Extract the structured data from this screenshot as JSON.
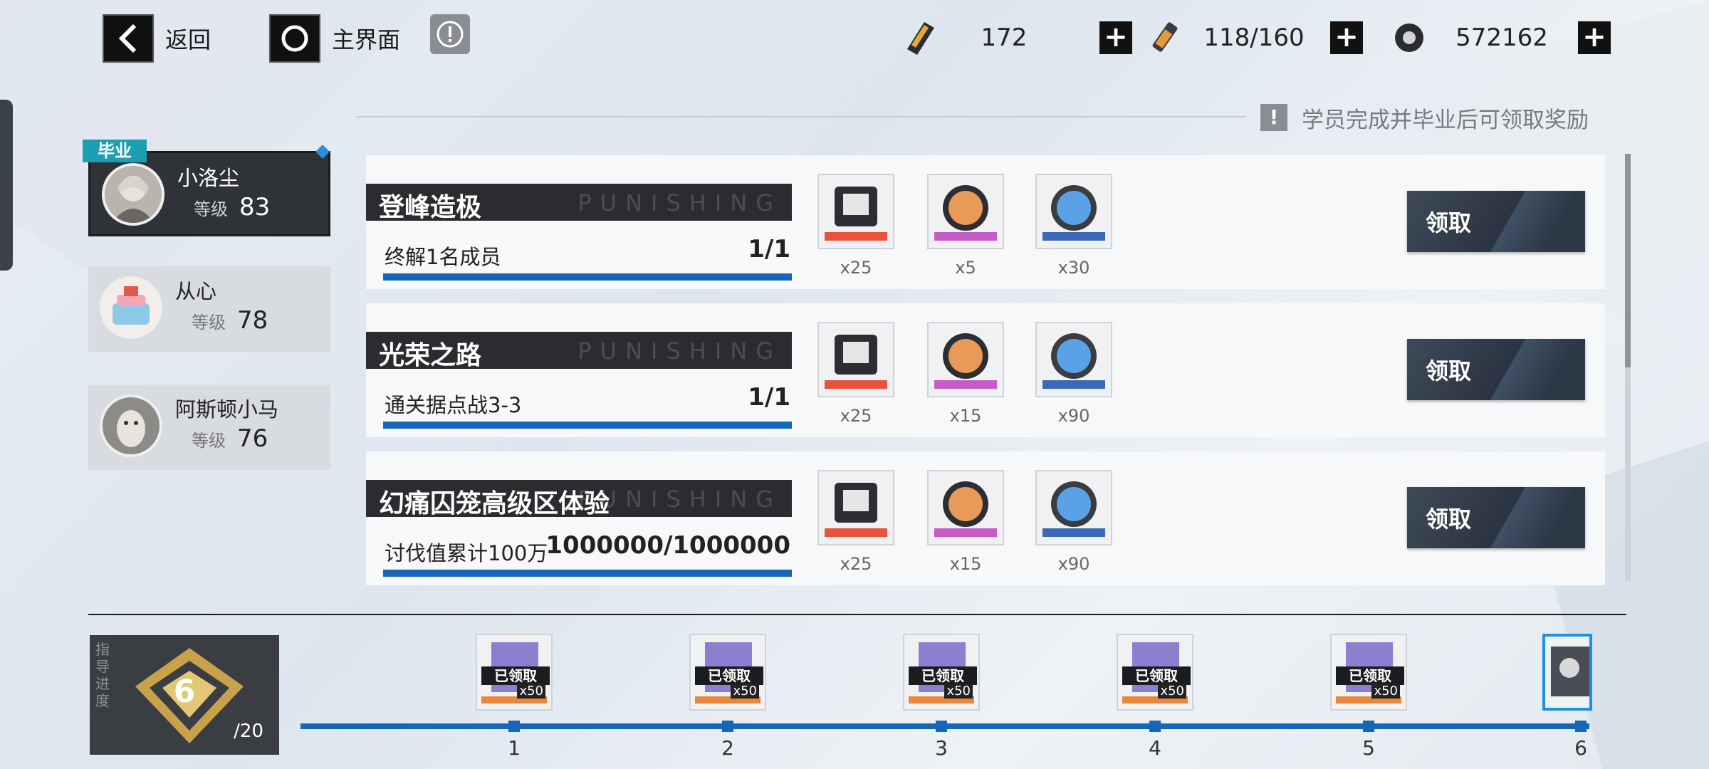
{
  "topbar": {
    "back_label": "返回",
    "home_label": "主界面",
    "resources": [
      {
        "icon": "ticket-icon",
        "value": "172"
      },
      {
        "icon": "battery-icon",
        "value": "118/160"
      },
      {
        "icon": "gear-coin-icon",
        "value": "572162"
      }
    ]
  },
  "notice": "学员完成并毕业后可领取奖励",
  "students": [
    {
      "name": "小洛尘",
      "level_label": "等级",
      "level": "83",
      "badge": "毕业"
    },
    {
      "name": "从心",
      "level_label": "等级",
      "level": "78"
    },
    {
      "name": "阿斯顿小马",
      "level_label": "等级",
      "level": "76"
    }
  ],
  "tasks": [
    {
      "title": "登峰造极",
      "watermark": "PUNISHING",
      "desc": "终解1名成员",
      "progress": "1/1",
      "rewards": [
        "x25",
        "x5",
        "x30"
      ],
      "claim": "领取"
    },
    {
      "title": "光荣之路",
      "watermark": "PUNISHING",
      "desc": "通关据点战3-3",
      "progress": "1/1",
      "rewards": [
        "x25",
        "x15",
        "x90"
      ],
      "claim": "领取"
    },
    {
      "title": "幻痛囚笼高级区体验",
      "watermark": "PUNISHING",
      "desc": "讨伐值累计100万",
      "progress": "1000000/1000000",
      "rewards": [
        "x25",
        "x15",
        "x90"
      ],
      "claim": "领取"
    }
  ],
  "guide": {
    "label": "指导进度",
    "current": "6",
    "total": "/20"
  },
  "milestones": [
    {
      "n": "1",
      "status": "已领取",
      "qty": "x50"
    },
    {
      "n": "2",
      "status": "已领取",
      "qty": "x50"
    },
    {
      "n": "3",
      "status": "已领取",
      "qty": "x50"
    },
    {
      "n": "4",
      "status": "已领取",
      "qty": "x50"
    },
    {
      "n": "5",
      "status": "已领取",
      "qty": "x50"
    },
    {
      "n": "6",
      "status": "",
      "qty": ""
    }
  ],
  "colors": {
    "accent": "#1565b8",
    "graduate_badge": "#1c9fb3",
    "dark": "#2a2c30"
  }
}
